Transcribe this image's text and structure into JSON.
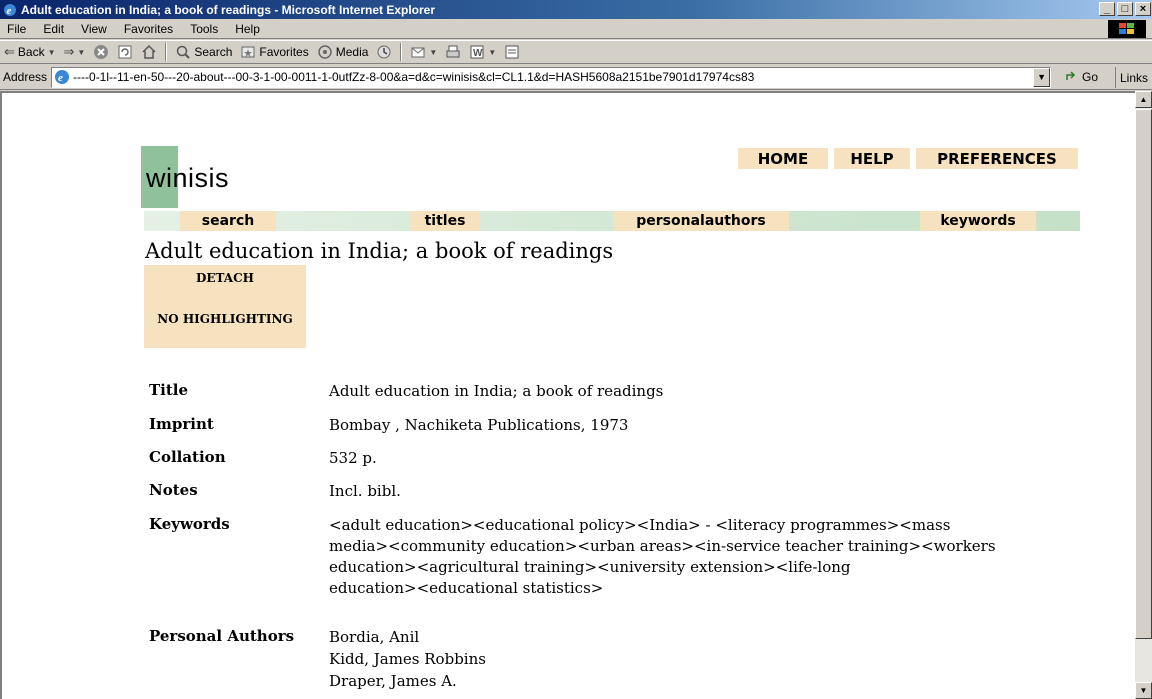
{
  "window": {
    "title": "Adult education in India; a book of readings - Microsoft Internet Explorer",
    "controls": [
      "_",
      "□",
      "×"
    ]
  },
  "menu": [
    "File",
    "Edit",
    "View",
    "Favorites",
    "Tools",
    "Help"
  ],
  "toolbar": {
    "back": "Back",
    "search": "Search",
    "favorites": "Favorites",
    "media": "Media"
  },
  "address": {
    "label": "Address",
    "url": "----0-1l--11-en-50---20-about---00-3-1-00-0011-1-0utfZz-8-00&a=d&c=winisis&cl=CL1.1&d=HASH5608a2151be7901d17974cs83",
    "go": "Go",
    "links": "Links"
  },
  "site": {
    "logo_a": "win",
    "logo_b": "isis",
    "topnav": {
      "home": "HOME",
      "help": "HELP",
      "preferences": "PREFERENCES"
    },
    "nav": {
      "search": "search",
      "titles": "titles",
      "authors": "personalauthors",
      "keywords": "keywords"
    }
  },
  "document": {
    "title": "Adult education in India; a book of readings",
    "detach": "DETACH",
    "no_highlighting": "NO HIGHLIGHTING",
    "fields": {
      "title_label": "Title",
      "title_value": "Adult education in India; a book of readings",
      "imprint_label": "Imprint",
      "imprint_value": "Bombay , Nachiketa Publications, 1973",
      "collation_label": "Collation",
      "collation_value": "532 p.",
      "notes_label": "Notes",
      "notes_value": "Incl. bibl.",
      "keywords_label": "Keywords",
      "keywords_line1": "<adult education><educational policy><India> - <literacy programmes><mass",
      "keywords_line2": "media><community education><urban areas><in-service teacher training><workers",
      "keywords_line3": "education><agricultural training><university extension><life-long",
      "keywords_line4": "education><educational statistics>",
      "authors_label": "Personal Authors",
      "author1": "Bordia, Anil",
      "author2": "Kidd, James Robbins",
      "author3": "Draper, James A."
    }
  },
  "colors": {
    "titlebar_start": "#0a246a",
    "logo_green": "#8fc19a",
    "nav_tan": "#f7e2c0",
    "nav_green": "#c4e1c8"
  },
  "icons": [
    "ie-logo-icon",
    "windows-flag-icon",
    "back-arrow-icon",
    "forward-arrow-icon",
    "stop-icon",
    "refresh-icon",
    "home-icon",
    "search-icon",
    "favorites-icon",
    "media-icon",
    "history-icon",
    "mail-icon",
    "print-icon",
    "edit-icon",
    "discuss-icon",
    "go-arrow-icon",
    "page-icon"
  ]
}
